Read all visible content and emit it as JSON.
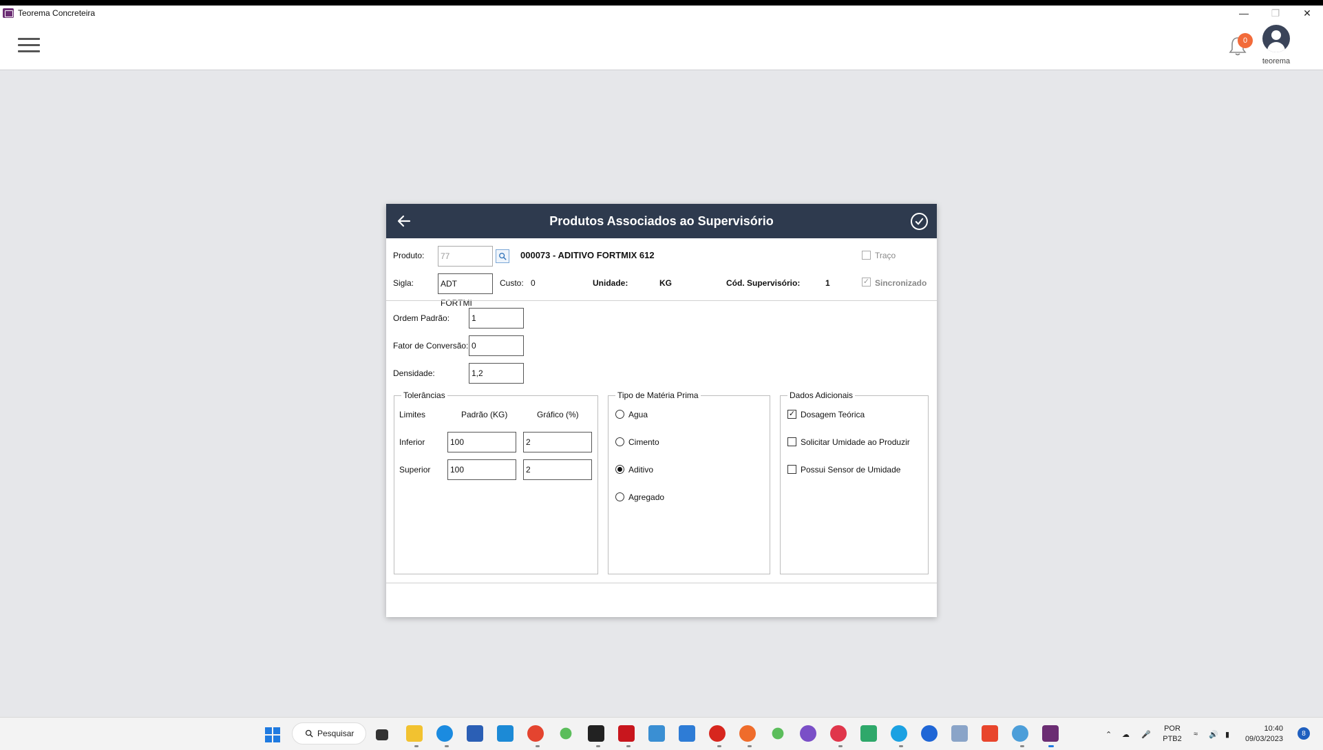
{
  "window": {
    "title": "Teorema Concreteira",
    "controls": [
      "minimize-icon",
      "restore-icon",
      "close-icon"
    ]
  },
  "appbar": {
    "notification_count": "0",
    "username": "teorema"
  },
  "dialog": {
    "title": "Produtos Associados ao Supervisório",
    "produto": {
      "label": "Produto:",
      "code_value": "77",
      "description": "000073 - ADITIVO FORTMIX 612"
    },
    "traco": {
      "label": "Traço",
      "checked": false
    },
    "sigla": {
      "label": "Sigla:",
      "value": "ADT FORTMI"
    },
    "custo": {
      "label": "Custo:",
      "value": "0"
    },
    "unidade": {
      "label": "Unidade:",
      "value": "KG"
    },
    "cod_supervisorio": {
      "label": "Cód. Supervisório:",
      "value": "1"
    },
    "sincronizado": {
      "label": "Sincronizado",
      "checked": true
    },
    "ordem_padrao": {
      "label": "Ordem Padrão:",
      "value": "1"
    },
    "fator_conversao": {
      "label": "Fator de Conversão:",
      "value": "0"
    },
    "densidade": {
      "label": "Densidade:",
      "value": "1,2"
    },
    "tolerancias": {
      "title": "Tolerâncias",
      "headers": [
        "Limites",
        "Padrão (KG)",
        "Gráfico (%)"
      ],
      "rows": [
        {
          "label": "Inferior",
          "padrao": "100",
          "grafico": "2"
        },
        {
          "label": "Superior",
          "padrao": "100",
          "grafico": "2"
        }
      ]
    },
    "tipo_materia_prima": {
      "title": "Tipo de Matéria Prima",
      "options": [
        "Agua",
        "Cimento",
        "Aditivo",
        "Agregado"
      ],
      "selected": "Aditivo"
    },
    "dados_adicionais": {
      "title": "Dados Adicionais",
      "items": [
        {
          "label": "Dosagem Teórica",
          "checked": true
        },
        {
          "label": "Solicitar Umidade ao Produzir",
          "checked": false
        },
        {
          "label": "Possui Sensor de Umidade",
          "checked": false
        }
      ]
    }
  },
  "taskbar": {
    "search_label": "Pesquisar",
    "lang_line1": "POR",
    "lang_line2": "PTB2",
    "time": "10:40",
    "date": "09/03/2023",
    "notification_badge": "8",
    "colors": {
      "accent": "#1f7ae0",
      "header": "#2e3a4e",
      "badge": "#f26b3a"
    }
  }
}
